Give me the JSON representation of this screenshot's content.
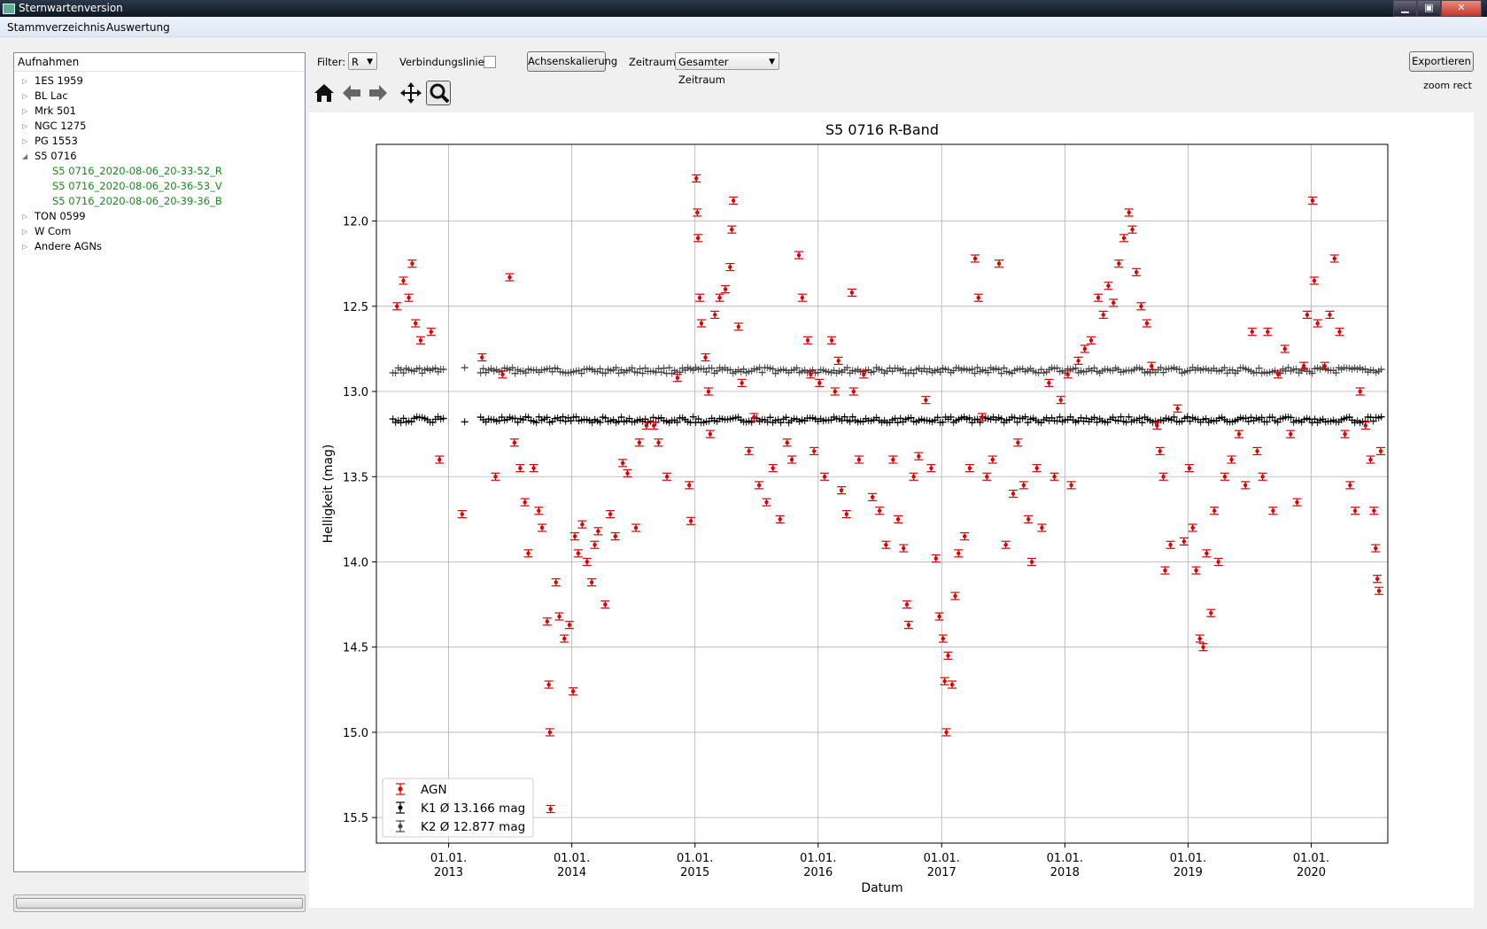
{
  "window": {
    "title": "Sternwartenversion",
    "min_label": "▁",
    "max_label": "▣",
    "close_label": "✕"
  },
  "menu": {
    "items": [
      "Stammverzeichnis",
      "Auswertung"
    ]
  },
  "tree": {
    "header": "Aufnahmen",
    "items": [
      {
        "label": "1ES 1959",
        "expanded": false
      },
      {
        "label": "BL Lac",
        "expanded": false
      },
      {
        "label": "Mrk 501",
        "expanded": false
      },
      {
        "label": "NGC 1275",
        "expanded": false
      },
      {
        "label": "PG 1553",
        "expanded": false
      },
      {
        "label": "S5 0716",
        "expanded": true,
        "children": [
          "S5 0716_2020-08-06_20-33-52_R",
          "S5 0716_2020-08-06_20-36-53_V",
          "S5 0716_2020-08-06_20-39-36_B"
        ]
      },
      {
        "label": "TON 0599",
        "expanded": false
      },
      {
        "label": "W Com",
        "expanded": false
      },
      {
        "label": "Andere AGNs",
        "expanded": false
      }
    ]
  },
  "controls": {
    "filter_label": "Filter:",
    "filter_value": "R",
    "lines_label": "Verbindungslinien:",
    "lines_checked": false,
    "scale_button": "Achsenskalierung",
    "period_label": "Zeitraum:",
    "period_value": "Gesamter Zeitraum",
    "export_button": "Exportieren"
  },
  "toolbar": {
    "tools": [
      "home-icon",
      "back-arrow-icon",
      "forward-arrow-icon",
      "pan-icon",
      "zoom-icon"
    ],
    "active": "zoom-icon",
    "mode_text": "zoom rect"
  },
  "chart_data": {
    "type": "scatter",
    "title": "S5 0716 R-Band",
    "xlabel": "Datum",
    "ylabel": "Helligkeit (mag)",
    "x_ticks": [
      "01.01.\n2013",
      "01.01.\n2014",
      "01.01.\n2015",
      "01.01.\n2016",
      "01.01.\n2017",
      "01.01.\n2018",
      "01.01.\n2019",
      "01.01.\n2020"
    ],
    "xlim": [
      "2012-06-01",
      "2020-08-15"
    ],
    "ylim": [
      15.65,
      11.55
    ],
    "y_ticks": [
      "12.0",
      "12.5",
      "13.0",
      "13.5",
      "14.0",
      "14.5",
      "15.0",
      "15.5"
    ],
    "y_inverted": true,
    "grid": true,
    "legend_position": "lower-left",
    "series": [
      {
        "name": "AGN",
        "color": "#dd0000",
        "points": [
          [
            "2012-08-01",
            12.5
          ],
          [
            "2012-08-20",
            12.35
          ],
          [
            "2012-09-05",
            12.45
          ],
          [
            "2012-09-15",
            12.25
          ],
          [
            "2012-09-25",
            12.6
          ],
          [
            "2012-10-10",
            12.7
          ],
          [
            "2012-11-10",
            12.65
          ],
          [
            "2012-12-05",
            13.4
          ],
          [
            "2013-02-10",
            13.72
          ],
          [
            "2013-04-10",
            12.8
          ],
          [
            "2013-05-20",
            13.5
          ],
          [
            "2013-06-10",
            12.9
          ],
          [
            "2013-07-01",
            12.33
          ],
          [
            "2013-07-15",
            13.3
          ],
          [
            "2013-08-01",
            13.45
          ],
          [
            "2013-08-15",
            13.65
          ],
          [
            "2013-08-25",
            13.95
          ],
          [
            "2013-09-10",
            13.45
          ],
          [
            "2013-09-25",
            13.7
          ],
          [
            "2013-10-05",
            13.8
          ],
          [
            "2013-10-20",
            14.35
          ],
          [
            "2013-10-25",
            14.72
          ],
          [
            "2013-10-28",
            15.0
          ],
          [
            "2013-10-30",
            15.45
          ],
          [
            "2013-11-15",
            14.12
          ],
          [
            "2013-11-25",
            14.32
          ],
          [
            "2013-12-10",
            14.45
          ],
          [
            "2013-12-25",
            14.37
          ],
          [
            "2014-01-05",
            14.76
          ],
          [
            "2014-01-10",
            13.85
          ],
          [
            "2014-01-20",
            13.95
          ],
          [
            "2014-02-01",
            13.78
          ],
          [
            "2014-02-15",
            14.0
          ],
          [
            "2014-03-01",
            14.12
          ],
          [
            "2014-03-10",
            13.9
          ],
          [
            "2014-03-20",
            13.82
          ],
          [
            "2014-04-10",
            14.25
          ],
          [
            "2014-04-25",
            13.72
          ],
          [
            "2014-05-10",
            13.85
          ],
          [
            "2014-06-01",
            13.42
          ],
          [
            "2014-06-15",
            13.48
          ],
          [
            "2014-07-10",
            13.8
          ],
          [
            "2014-07-20",
            13.3
          ],
          [
            "2014-08-10",
            13.2
          ],
          [
            "2014-09-01",
            13.2
          ],
          [
            "2014-09-15",
            13.3
          ],
          [
            "2014-10-10",
            13.5
          ],
          [
            "2014-11-10",
            12.92
          ],
          [
            "2014-12-15",
            13.55
          ],
          [
            "2014-12-20",
            13.76
          ],
          [
            "2015-01-05",
            11.75
          ],
          [
            "2015-01-08",
            11.95
          ],
          [
            "2015-01-10",
            12.1
          ],
          [
            "2015-01-15",
            12.45
          ],
          [
            "2015-01-20",
            12.6
          ],
          [
            "2015-02-01",
            12.8
          ],
          [
            "2015-02-10",
            13.0
          ],
          [
            "2015-02-15",
            13.25
          ],
          [
            "2015-03-01",
            12.55
          ],
          [
            "2015-03-15",
            12.45
          ],
          [
            "2015-04-01",
            12.4
          ],
          [
            "2015-04-15",
            12.27
          ],
          [
            "2015-04-20",
            12.05
          ],
          [
            "2015-04-25",
            11.88
          ],
          [
            "2015-05-10",
            12.62
          ],
          [
            "2015-05-20",
            12.95
          ],
          [
            "2015-06-10",
            13.35
          ],
          [
            "2015-06-25",
            13.15
          ],
          [
            "2015-07-10",
            13.55
          ],
          [
            "2015-08-01",
            13.65
          ],
          [
            "2015-08-20",
            13.45
          ],
          [
            "2015-09-10",
            13.75
          ],
          [
            "2015-10-01",
            13.3
          ],
          [
            "2015-10-15",
            13.4
          ],
          [
            "2015-11-05",
            12.2
          ],
          [
            "2015-11-15",
            12.45
          ],
          [
            "2015-12-01",
            12.7
          ],
          [
            "2015-12-10",
            12.9
          ],
          [
            "2015-12-20",
            13.35
          ],
          [
            "2016-01-05",
            12.95
          ],
          [
            "2016-01-20",
            13.5
          ],
          [
            "2016-02-10",
            12.7
          ],
          [
            "2016-02-20",
            13.0
          ],
          [
            "2016-03-01",
            12.82
          ],
          [
            "2016-03-10",
            13.58
          ],
          [
            "2016-03-25",
            13.72
          ],
          [
            "2016-04-10",
            12.42
          ],
          [
            "2016-04-15",
            13.0
          ],
          [
            "2016-05-01",
            13.4
          ],
          [
            "2016-05-15",
            12.9
          ],
          [
            "2016-06-10",
            13.62
          ],
          [
            "2016-07-01",
            13.7
          ],
          [
            "2016-07-20",
            13.9
          ],
          [
            "2016-08-10",
            13.4
          ],
          [
            "2016-08-25",
            13.75
          ],
          [
            "2016-09-10",
            13.92
          ],
          [
            "2016-09-20",
            14.25
          ],
          [
            "2016-09-25",
            14.37
          ],
          [
            "2016-10-10",
            13.5
          ],
          [
            "2016-10-25",
            13.38
          ],
          [
            "2016-11-15",
            13.05
          ],
          [
            "2016-12-01",
            13.45
          ],
          [
            "2016-12-15",
            13.98
          ],
          [
            "2016-12-25",
            14.32
          ],
          [
            "2017-01-05",
            14.45
          ],
          [
            "2017-01-10",
            14.7
          ],
          [
            "2017-01-15",
            15.0
          ],
          [
            "2017-01-20",
            14.55
          ],
          [
            "2017-02-01",
            14.72
          ],
          [
            "2017-02-10",
            14.2
          ],
          [
            "2017-02-20",
            13.95
          ],
          [
            "2017-03-10",
            13.85
          ],
          [
            "2017-03-25",
            13.45
          ],
          [
            "2017-04-10",
            12.22
          ],
          [
            "2017-04-20",
            12.45
          ],
          [
            "2017-05-01",
            13.15
          ],
          [
            "2017-05-15",
            13.5
          ],
          [
            "2017-06-01",
            13.4
          ],
          [
            "2017-06-20",
            12.25
          ],
          [
            "2017-07-10",
            13.9
          ],
          [
            "2017-08-01",
            13.6
          ],
          [
            "2017-08-15",
            13.3
          ],
          [
            "2017-09-01",
            13.55
          ],
          [
            "2017-09-15",
            13.75
          ],
          [
            "2017-09-25",
            14.0
          ],
          [
            "2017-10-10",
            13.45
          ],
          [
            "2017-10-25",
            13.8
          ],
          [
            "2017-11-15",
            12.95
          ],
          [
            "2017-12-01",
            13.5
          ],
          [
            "2017-12-20",
            13.05
          ],
          [
            "2018-01-10",
            12.9
          ],
          [
            "2018-01-20",
            13.55
          ],
          [
            "2018-02-10",
            12.82
          ],
          [
            "2018-03-01",
            12.75
          ],
          [
            "2018-03-20",
            12.7
          ],
          [
            "2018-04-10",
            12.45
          ],
          [
            "2018-04-25",
            12.55
          ],
          [
            "2018-05-10",
            12.38
          ],
          [
            "2018-05-25",
            12.48
          ],
          [
            "2018-06-10",
            12.25
          ],
          [
            "2018-06-25",
            12.1
          ],
          [
            "2018-07-10",
            11.95
          ],
          [
            "2018-07-20",
            12.05
          ],
          [
            "2018-08-01",
            12.3
          ],
          [
            "2018-08-15",
            12.5
          ],
          [
            "2018-09-01",
            12.6
          ],
          [
            "2018-09-15",
            12.85
          ],
          [
            "2018-10-01",
            13.2
          ],
          [
            "2018-10-10",
            13.35
          ],
          [
            "2018-10-20",
            13.5
          ],
          [
            "2018-10-25",
            14.05
          ],
          [
            "2018-11-10",
            13.9
          ],
          [
            "2018-12-01",
            13.1
          ],
          [
            "2018-12-20",
            13.88
          ],
          [
            "2019-01-05",
            13.45
          ],
          [
            "2019-01-15",
            13.8
          ],
          [
            "2019-01-25",
            14.05
          ],
          [
            "2019-02-05",
            14.45
          ],
          [
            "2019-02-15",
            14.5
          ],
          [
            "2019-02-25",
            13.95
          ],
          [
            "2019-03-10",
            14.3
          ],
          [
            "2019-03-20",
            13.7
          ],
          [
            "2019-04-01",
            14.0
          ],
          [
            "2019-04-20",
            13.5
          ],
          [
            "2019-05-10",
            13.4
          ],
          [
            "2019-06-01",
            13.25
          ],
          [
            "2019-06-20",
            13.55
          ],
          [
            "2019-07-10",
            12.65
          ],
          [
            "2019-07-25",
            13.35
          ],
          [
            "2019-08-10",
            13.5
          ],
          [
            "2019-08-25",
            12.65
          ],
          [
            "2019-09-10",
            13.7
          ],
          [
            "2019-09-25",
            12.9
          ],
          [
            "2019-10-15",
            12.75
          ],
          [
            "2019-11-01",
            13.25
          ],
          [
            "2019-11-20",
            13.65
          ],
          [
            "2019-12-10",
            12.85
          ],
          [
            "2019-12-20",
            12.55
          ],
          [
            "2020-01-05",
            11.88
          ],
          [
            "2020-01-10",
            12.35
          ],
          [
            "2020-01-20",
            12.6
          ],
          [
            "2020-02-10",
            12.85
          ],
          [
            "2020-02-25",
            12.55
          ],
          [
            "2020-03-10",
            12.22
          ],
          [
            "2020-03-25",
            12.65
          ],
          [
            "2020-04-10",
            13.25
          ],
          [
            "2020-04-25",
            13.55
          ],
          [
            "2020-05-10",
            13.7
          ],
          [
            "2020-05-25",
            13.0
          ],
          [
            "2020-06-10",
            13.2
          ],
          [
            "2020-06-25",
            13.4
          ],
          [
            "2020-07-05",
            13.7
          ],
          [
            "2020-07-10",
            13.92
          ],
          [
            "2020-07-15",
            14.1
          ],
          [
            "2020-07-20",
            14.17
          ],
          [
            "2020-07-25",
            13.35
          ]
        ]
      },
      {
        "name": "K1 Ø 13.166 mag",
        "color": "#000000",
        "mean": 13.166,
        "start": "2012-07-20",
        "end": "2020-07-31"
      },
      {
        "name": "K2 Ø 12.877 mag",
        "color": "#444444",
        "mean": 12.877,
        "start": "2012-07-20",
        "end": "2020-07-31"
      }
    ]
  }
}
